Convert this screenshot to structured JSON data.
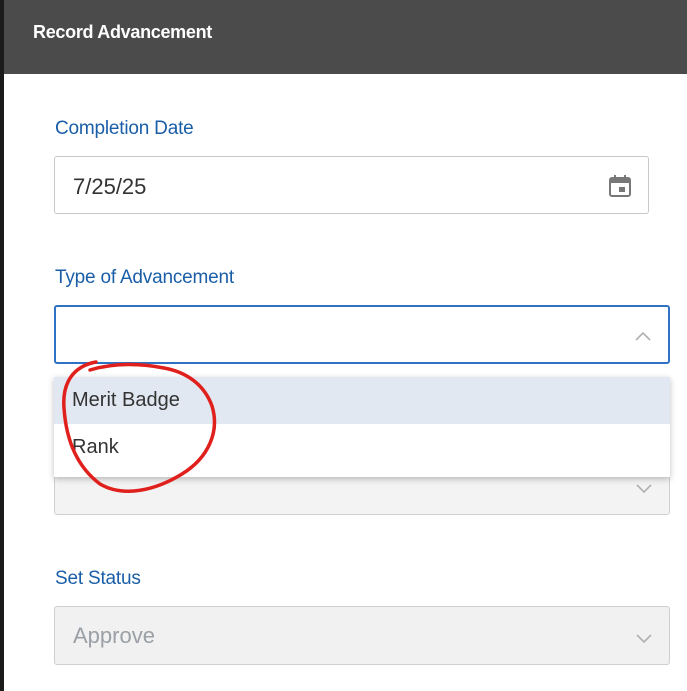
{
  "dialog": {
    "title": "Record Advancement"
  },
  "completion_date": {
    "label": "Completion Date",
    "value": "7/25/25",
    "icon": "calendar-icon"
  },
  "type_of_advancement": {
    "label": "Type of Advancement",
    "value": "",
    "expanded": true,
    "options": [
      {
        "label": "Merit Badge",
        "highlighted": true
      },
      {
        "label": "Rank",
        "highlighted": false
      }
    ]
  },
  "set_status": {
    "label": "Set Status",
    "value": "Approve",
    "disabled": true
  },
  "colors": {
    "header": "#4b4b4b",
    "label": "#1a5ea8",
    "focus_border": "#2f72c4",
    "annotation": "#e0201c"
  }
}
